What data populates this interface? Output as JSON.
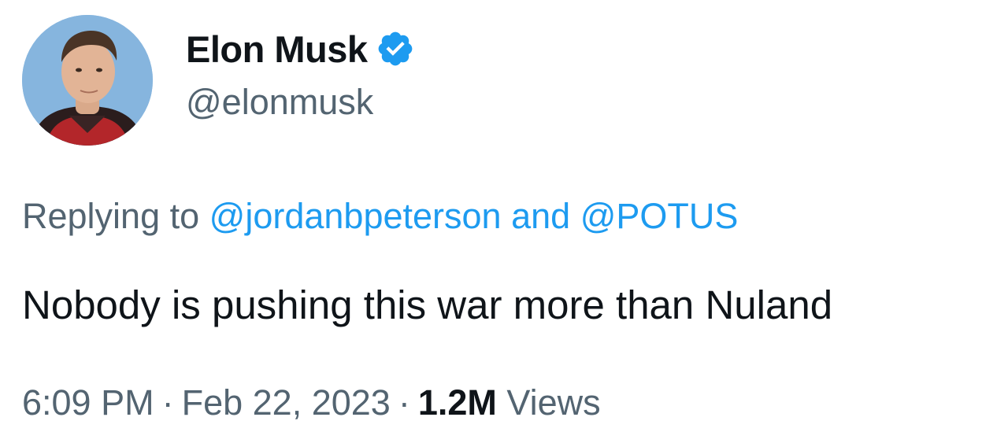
{
  "author": {
    "display_name": "Elon Musk",
    "handle": "@elonmusk",
    "verified": true,
    "avatar_icon": "profile-photo"
  },
  "reply": {
    "prefix": "Replying to",
    "mentions": [
      "@jordanbpeterson",
      "@POTUS"
    ],
    "joiner": "and"
  },
  "tweet": {
    "text": "Nobody is pushing this war more than Nuland"
  },
  "meta": {
    "time": "6:09 PM",
    "separator": "·",
    "date": "Feb 22, 2023",
    "views_count": "1.2M",
    "views_label": "Views"
  },
  "colors": {
    "accent": "#1d9bf0",
    "secondary_text": "#536471",
    "primary_text": "#0f1419",
    "background": "#ffffff"
  }
}
